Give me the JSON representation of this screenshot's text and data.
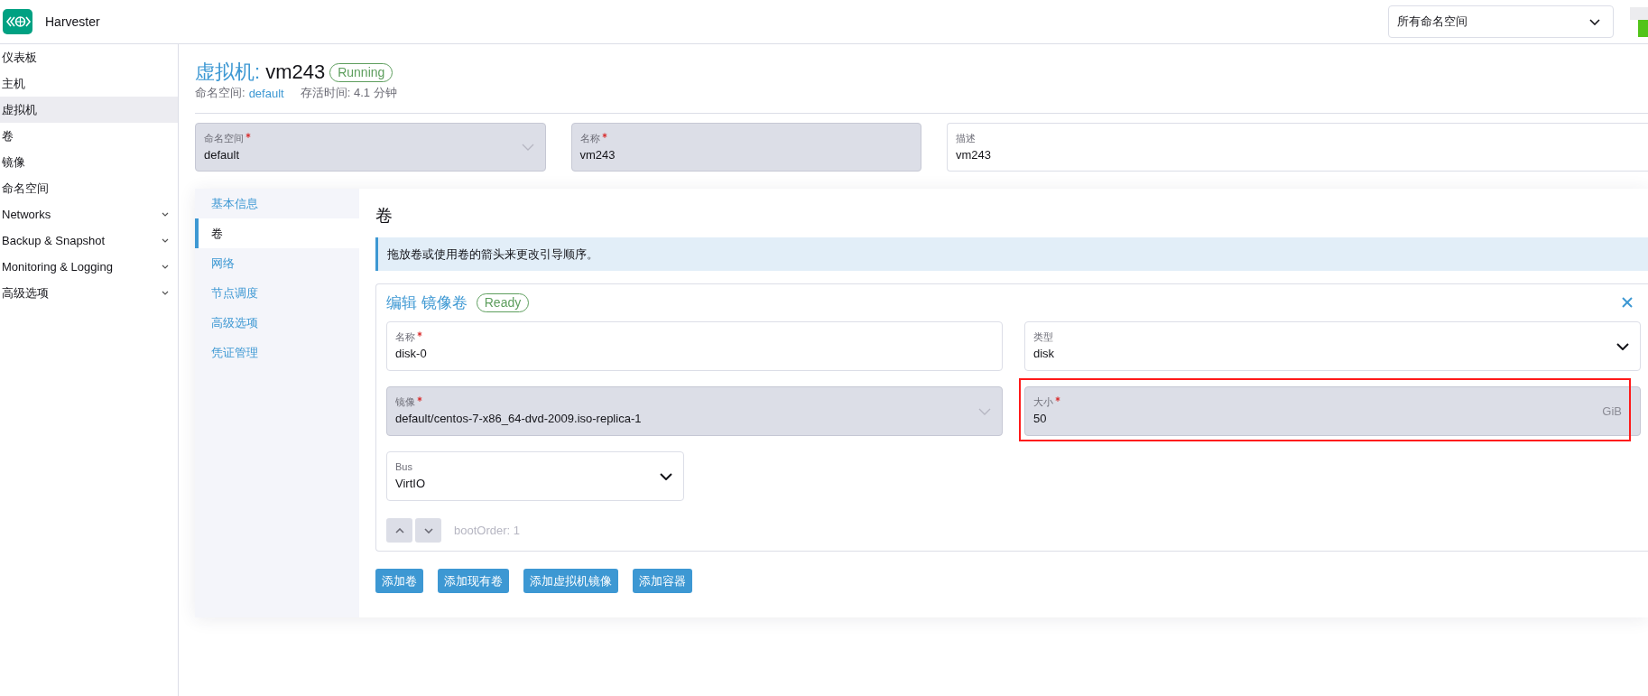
{
  "header": {
    "app_name": "Harvester",
    "namespace_filter": "所有命名空间"
  },
  "sidebar": {
    "items": [
      {
        "label": "仪表板",
        "kind": "link",
        "selected": false
      },
      {
        "label": "主机",
        "kind": "link",
        "selected": false
      },
      {
        "label": "虚拟机",
        "kind": "link",
        "selected": true
      },
      {
        "label": "卷",
        "kind": "link",
        "selected": false
      },
      {
        "label": "镜像",
        "kind": "link",
        "selected": false
      },
      {
        "label": "命名空间",
        "kind": "link",
        "selected": false
      },
      {
        "label": "Networks",
        "kind": "group",
        "selected": false
      },
      {
        "label": "Backup & Snapshot",
        "kind": "group",
        "selected": false
      },
      {
        "label": "Monitoring & Logging",
        "kind": "group",
        "selected": false
      },
      {
        "label": "高级选项",
        "kind": "group",
        "selected": false
      }
    ]
  },
  "page_header": {
    "title_type": "虚拟机:",
    "title_name": "vm243",
    "status": "Running",
    "namespace_label": "命名空间:",
    "namespace": "default",
    "age": "存活时间: 4.1 分钟"
  },
  "top_fields": [
    {
      "label": "命名空间",
      "required": true,
      "value": "default",
      "kind": "select",
      "disabled": true
    },
    {
      "label": "名称",
      "required": true,
      "value": "vm243",
      "kind": "text",
      "disabled": true
    },
    {
      "label": "描述",
      "required": false,
      "value": "vm243",
      "kind": "text",
      "disabled": false
    }
  ],
  "tabs": [
    {
      "label": "基本信息",
      "selected": false
    },
    {
      "label": "卷",
      "selected": true
    },
    {
      "label": "网络",
      "selected": false
    },
    {
      "label": "节点调度",
      "selected": false
    },
    {
      "label": "高级选项",
      "selected": false
    },
    {
      "label": "凭证管理",
      "selected": false
    }
  ],
  "volumes": {
    "heading": "卷",
    "notice": "拖放卷或使用卷的箭头来更改引导顺序。",
    "card": {
      "title": "编辑 镜像卷",
      "status": "Ready",
      "rows": [
        [
          {
            "label": "名称",
            "required": true,
            "value": "disk-0",
            "kind": "text",
            "disabled": false,
            "highlighted": false
          },
          {
            "label": "类型",
            "required": false,
            "value": "disk",
            "kind": "select",
            "disabled": false,
            "highlighted": false
          }
        ],
        [
          {
            "label": "镜像",
            "required": true,
            "value": "default/centos-7-x86_64-dvd-2009.iso-replica-1",
            "kind": "select",
            "disabled": true,
            "highlighted": false
          },
          {
            "label": "大小",
            "required": true,
            "value": "50",
            "suffix": "GiB",
            "kind": "text",
            "disabled": true,
            "highlighted": true
          }
        ],
        [
          {
            "label": "Bus",
            "required": false,
            "value": "VirtIO",
            "kind": "select",
            "disabled": false,
            "highlighted": false
          }
        ]
      ],
      "boot_order": "bootOrder: 1"
    },
    "add_buttons": [
      "添加卷",
      "添加现有卷",
      "添加虚拟机镜像",
      "添加容器"
    ]
  }
}
